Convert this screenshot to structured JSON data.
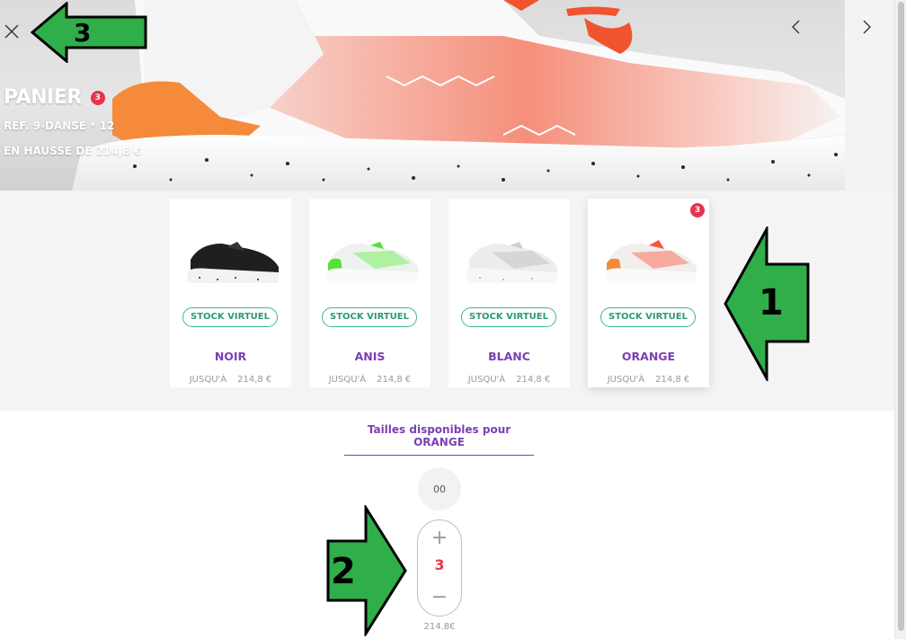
{
  "header": {
    "title": "PANIER",
    "cart_count": "3",
    "reference": "RÉF. 9-DANSE * 12",
    "price_rise": "EN HAUSSE DE 214,8 €"
  },
  "colors": {
    "accent": "#7b3fb3",
    "badge": "#e8344e",
    "stock": "#3cb98a",
    "annotation_green": "#2fae4a"
  },
  "variants": [
    {
      "name": "NOIR",
      "stock_label": "STOCK VIRTUEL",
      "price_prefix": "JUSQU'À",
      "price": "214,8 €",
      "shoe_color": "#1f1f1f",
      "accent_color": "#2a2a2a",
      "selected": false,
      "badge": ""
    },
    {
      "name": "ANIS",
      "stock_label": "STOCK VIRTUEL",
      "price_prefix": "JUSQU'À",
      "price": "214,8 €",
      "shoe_color": "#eef2ee",
      "accent_color": "#55e03a",
      "selected": false,
      "badge": ""
    },
    {
      "name": "BLANC",
      "stock_label": "STOCK VIRTUEL",
      "price_prefix": "JUSQU'À",
      "price": "214,8 €",
      "shoe_color": "#f0f0f0",
      "accent_color": "#d9d9d9",
      "selected": false,
      "badge": ""
    },
    {
      "name": "ORANGE",
      "stock_label": "STOCK VIRTUEL",
      "price_prefix": "JUSQU'À",
      "price": "214,8 €",
      "shoe_color": "#f3eeee",
      "accent_color": "#f25a3d",
      "selected": true,
      "badge": "3"
    }
  ],
  "sizes": {
    "title": "Tailles disponibles pour ORANGE",
    "size_label": "00",
    "plus": "+",
    "quantity": "3",
    "minus": "−",
    "unit_price": "214.8€"
  },
  "annotations": [
    {
      "label": "3",
      "direction": "left"
    },
    {
      "label": "1",
      "direction": "left"
    },
    {
      "label": "2",
      "direction": "right"
    }
  ],
  "icons": {
    "close": "close-icon",
    "prev": "chevron-left-icon",
    "next": "chevron-right-icon"
  }
}
